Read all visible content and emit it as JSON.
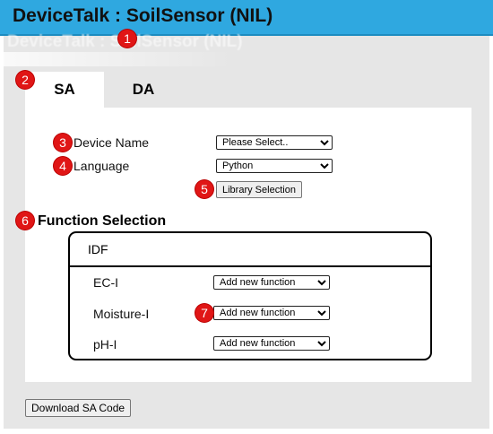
{
  "window": {
    "title": "DeviceTalk : SoilSensor (NIL)"
  },
  "tabs": [
    {
      "label": "SA",
      "active": true
    },
    {
      "label": "DA",
      "active": false
    }
  ],
  "form": {
    "device_name_label": "Device Name",
    "device_name_value": "Please Select..",
    "language_label": "Language",
    "language_value": "Python",
    "library_button": "Library Selection"
  },
  "function_selection": {
    "title": "Function Selection",
    "idf_header": "IDF",
    "rows": [
      {
        "label": "EC-I",
        "value": "Add new function"
      },
      {
        "label": "Moisture-I",
        "value": "Add new function"
      },
      {
        "label": "pH-I",
        "value": "Add new function"
      }
    ]
  },
  "footer": {
    "download_button": "Download SA Code"
  },
  "badges": [
    "1",
    "2",
    "3",
    "4",
    "5",
    "6",
    "7"
  ],
  "colors": {
    "accent": "#2fa8e0",
    "badge": "#e01616",
    "background": "#e6e6e6"
  }
}
